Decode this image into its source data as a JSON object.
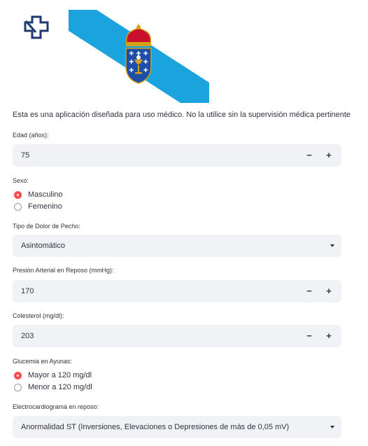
{
  "header": {
    "logo_icon": "health-cross-icon",
    "flag_icon": "galicia-flag-icon",
    "notice": "Esta es una aplicación diseñada para uso médico. No la utilice sin la supervisión médica pertinente"
  },
  "form": {
    "age": {
      "label": "Edad (años):",
      "value": "75",
      "minus": "−",
      "plus": "+"
    },
    "sex": {
      "label": "Sexo:",
      "options": [
        {
          "label": "Masculino",
          "selected": true
        },
        {
          "label": "Femenino",
          "selected": false
        }
      ]
    },
    "chest_pain": {
      "label": "Tipo de Dolor de Pecho:",
      "value": "Asintomático"
    },
    "blood_pressure": {
      "label": "Presión Arterial en Reposo (mmHg):",
      "value": "170",
      "minus": "−",
      "plus": "+"
    },
    "cholesterol": {
      "label": "Colesterol (mg/dl):",
      "value": "203",
      "minus": "−",
      "plus": "+"
    },
    "glucose": {
      "label": "Glucemia en Ayunas:",
      "options": [
        {
          "label": "Mayor a 120 mg/dl",
          "selected": true
        },
        {
          "label": "Menor a 120 mg/dl",
          "selected": false
        }
      ]
    },
    "ecg": {
      "label": "Electrocardiograma en reposo:",
      "value": "Anormalidad ST (Inversiones, Elevaciones o Depresiones de más de 0,05 mV)"
    }
  },
  "colors": {
    "accent": "#ff4b4b",
    "field_bg": "#f0f2f6",
    "flag_blue": "#1aa3dd",
    "logo_navy": "#1d3a72"
  }
}
